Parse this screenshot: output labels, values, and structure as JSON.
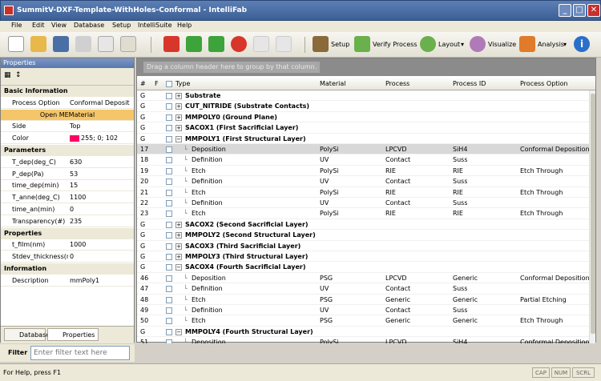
{
  "window": {
    "title": "SummitV-DXF-Template-WithHoles-Conformal - IntelliFab",
    "min": "_",
    "max": "□",
    "close": "✕"
  },
  "menu": [
    "File",
    "Edit",
    "View",
    "Database",
    "Setup",
    "IntelliSuite",
    "Help"
  ],
  "toolbar": {
    "setup": "Setup",
    "verify": "Verify Process",
    "layout": "Layout",
    "visualize": "Visualize",
    "analysis": "Analysis"
  },
  "properties": {
    "title": "Properties",
    "rows": [
      {
        "cat": true,
        "k": "Basic Information"
      },
      {
        "k": "Process Option",
        "v": "Conformal Deposit"
      },
      {
        "button": "Open MEMaterial"
      },
      {
        "k": "Side",
        "v": "Top"
      },
      {
        "k": "Color",
        "v": "255; 0; 102"
      },
      {
        "cat": true,
        "k": "Parameters"
      },
      {
        "k": "T_dep(deg_C)",
        "v": "630"
      },
      {
        "k": "P_dep(Pa)",
        "v": "53"
      },
      {
        "k": "time_dep(min)",
        "v": "15"
      },
      {
        "k": "T_anne(deg_C)",
        "v": "1100"
      },
      {
        "k": "time_an(min)",
        "v": "0"
      },
      {
        "k": "Transparency(#)",
        "v": "235"
      },
      {
        "cat": true,
        "k": "Properties"
      },
      {
        "k": "t_film(nm)",
        "v": "1000"
      },
      {
        "k": "Stdev_thickness(nm",
        "v": "0"
      },
      {
        "cat": true,
        "k": "Information"
      },
      {
        "k": "Description",
        "v": "mmPoly1"
      }
    ],
    "tabs": {
      "database": "Database",
      "properties": "Properties"
    },
    "colors": {
      "swatch": "#ff0066"
    }
  },
  "filter": {
    "label": "Filter",
    "placeholder": "Enter filter text here"
  },
  "grid": {
    "group_hint": "Drag a column header here to group by that column.",
    "columns": {
      "num": "#",
      "flag": "F",
      "type": "Type",
      "material": "Material",
      "process": "Process",
      "pid": "Process ID",
      "popt": "Process Option"
    },
    "rows": [
      {
        "n": "G",
        "exp": "+",
        "t": "Substrate",
        "g": true
      },
      {
        "n": "G",
        "exp": "+",
        "t": "CUT_NITRIDE (Substrate Contacts)",
        "g": true
      },
      {
        "n": "G",
        "exp": "+",
        "t": "MMPOLY0 (Ground Plane)",
        "g": true
      },
      {
        "n": "G",
        "exp": "+",
        "t": "SACOX1 (First Sacrificial Layer)",
        "g": true
      },
      {
        "n": "G",
        "exp": "−",
        "t": "MMPOLY1 (First Structural Layer)",
        "g": true
      },
      {
        "n": "17",
        "t": "Deposition",
        "m": "PolySi",
        "p": "LPCVD",
        "id": "SiH4",
        "o": "Conformal Deposition",
        "sel": true
      },
      {
        "n": "18",
        "t": "Definition",
        "m": "UV",
        "p": "Contact",
        "id": "Suss",
        "o": ""
      },
      {
        "n": "19",
        "t": "Etch",
        "m": "PolySi",
        "p": "RIE",
        "id": "RIE",
        "o": "Etch Through"
      },
      {
        "n": "20",
        "t": "Definition",
        "m": "UV",
        "p": "Contact",
        "id": "Suss",
        "o": ""
      },
      {
        "n": "21",
        "t": "Etch",
        "m": "PolySi",
        "p": "RIE",
        "id": "RIE",
        "o": "Etch Through"
      },
      {
        "n": "22",
        "t": "Definition",
        "m": "UV",
        "p": "Contact",
        "id": "Suss",
        "o": ""
      },
      {
        "n": "23",
        "t": "Etch",
        "m": "PolySi",
        "p": "RIE",
        "id": "RIE",
        "o": "Etch Through"
      },
      {
        "n": "G",
        "exp": "+",
        "t": "SACOX2 (Second Sacrificial Layer)",
        "g": true
      },
      {
        "n": "G",
        "exp": "+",
        "t": "MMPOLY2 (Second Structural Layer)",
        "g": true
      },
      {
        "n": "G",
        "exp": "+",
        "t": "SACOX3 (Third Sacrificial Layer)",
        "g": true
      },
      {
        "n": "G",
        "exp": "+",
        "t": "MMPOLY3 (Third Structural Layer)",
        "g": true
      },
      {
        "n": "G",
        "exp": "−",
        "t": "SACOX4 (Fourth Sacrificial Layer)",
        "g": true
      },
      {
        "n": "46",
        "t": "Deposition",
        "m": "PSG",
        "p": "LPCVD",
        "id": "Generic",
        "o": "Conformal Deposition"
      },
      {
        "n": "47",
        "t": "Definition",
        "m": "UV",
        "p": "Contact",
        "id": "Suss",
        "o": ""
      },
      {
        "n": "48",
        "t": "Etch",
        "m": "PSG",
        "p": "Generic",
        "id": "Generic",
        "o": "Partial Etching"
      },
      {
        "n": "49",
        "t": "Definition",
        "m": "UV",
        "p": "Contact",
        "id": "Suss",
        "o": ""
      },
      {
        "n": "50",
        "t": "Etch",
        "m": "PSG",
        "p": "Generic",
        "id": "Generic",
        "o": "Etch Through"
      },
      {
        "n": "G",
        "exp": "−",
        "t": "MMPOLY4 (Fourth Structural Layer)",
        "g": true
      },
      {
        "n": "51",
        "t": "Deposition",
        "m": "PolySi",
        "p": "LPCVD",
        "id": "SiH4",
        "o": "Conformal Deposition"
      }
    ]
  },
  "status": {
    "text": "For Help, press F1",
    "cap": "CAP",
    "num": "NUM",
    "scrl": "SCRL"
  }
}
